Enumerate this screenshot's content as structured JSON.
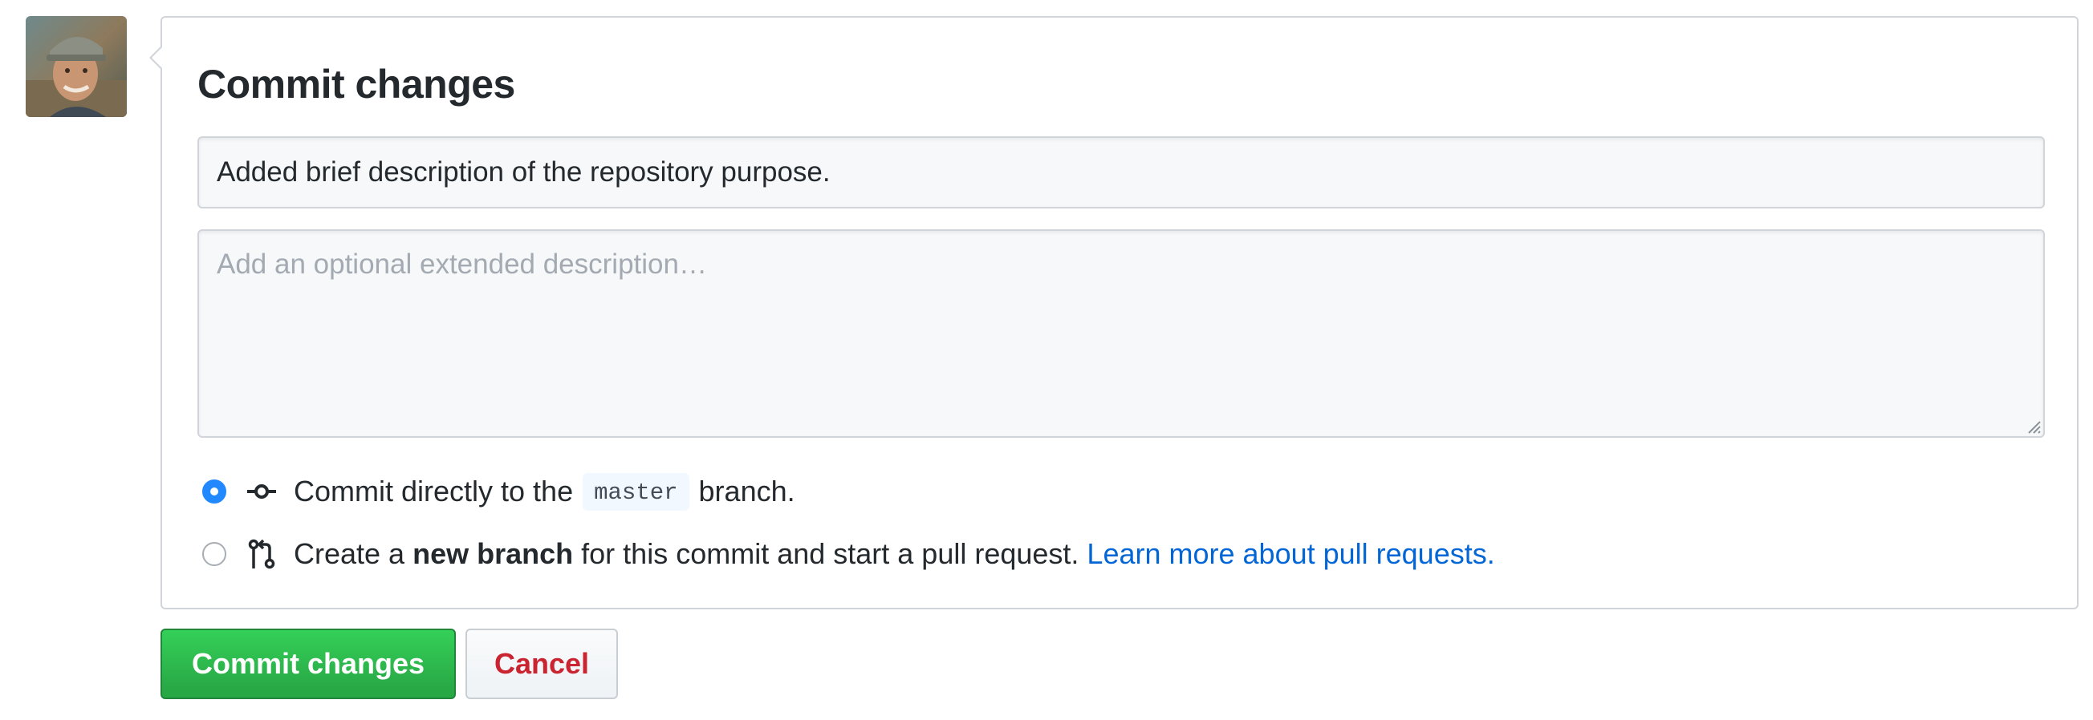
{
  "commit_form": {
    "title": "Commit changes",
    "summary_value": "Added brief description of the repository purpose.",
    "description_placeholder": "Add an optional extended description…"
  },
  "options": {
    "direct": {
      "checked": true,
      "prefix": "Commit directly to the",
      "branch_name": "master",
      "suffix": "branch."
    },
    "new_branch": {
      "checked": false,
      "prefix": "Create a",
      "emphasis": "new branch",
      "suffix": "for this commit and start a pull request.",
      "link_label": "Learn more about pull requests."
    }
  },
  "actions": {
    "commit_label": "Commit changes",
    "cancel_label": "Cancel"
  },
  "icons": {
    "direct": "git-commit-icon",
    "new_branch": "git-pull-request-icon"
  },
  "colors": {
    "primary_button": "#28a745",
    "cancel_text": "#cb2431",
    "link": "#0366d6",
    "radio_checked": "#2188ff"
  }
}
